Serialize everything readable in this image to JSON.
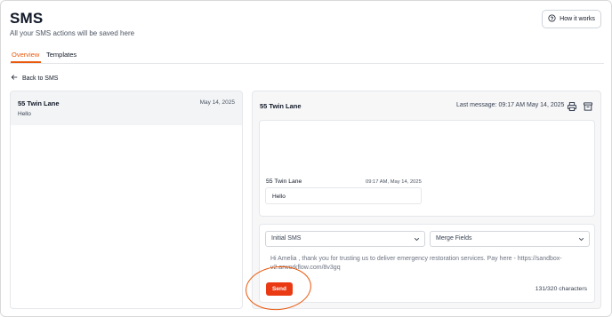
{
  "header": {
    "title": "SMS",
    "subtitle": "All your SMS actions will be saved here",
    "help_button_label": "How it works"
  },
  "tabs": [
    {
      "label": "Overview",
      "active": true
    },
    {
      "label": "Templates",
      "active": false
    }
  ],
  "back_link": "Back to SMS",
  "threads": [
    {
      "name": "55 Twin Lane",
      "date": "May 14, 2025",
      "preview": "Hello"
    }
  ],
  "conversation": {
    "name": "55 Twin Lane",
    "last_message": "Last message: 09:17 AM May 14, 2025",
    "messages": [
      {
        "sender": "55 Twin Lane",
        "time": "09:17 AM, May 14, 2025",
        "text": "Hello"
      }
    ]
  },
  "composer": {
    "template_select": "Initial SMS",
    "merge_fields_select": "Merge Fields",
    "message_text": "Hi Amelia , thank you for trusting us to deliver emergency restoration services. Pay here - https://sandbox-v2.arworkflow.com/8v3gq",
    "send_label": "Send",
    "char_count": "131/320 characters"
  },
  "colors": {
    "accent": "#ea580c",
    "send_button": "#ea3a14"
  }
}
